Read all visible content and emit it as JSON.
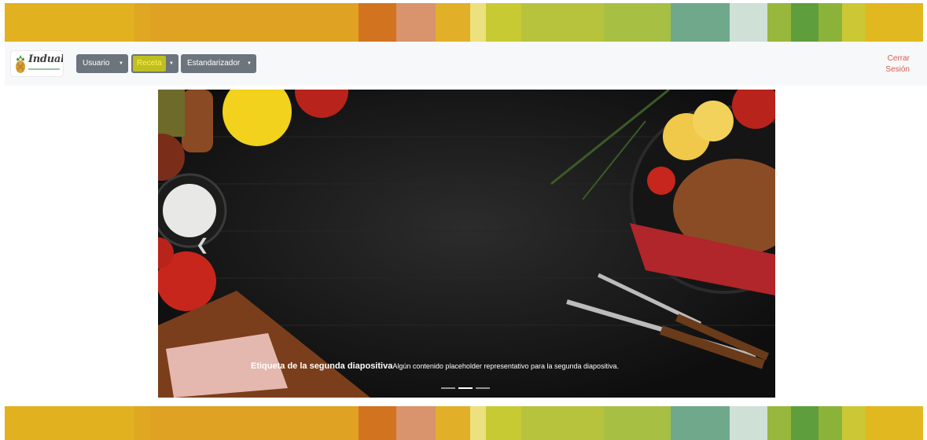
{
  "stripes": [
    {
      "color": "#e2b11f",
      "w": 165
    },
    {
      "color": "#e0a722",
      "w": 20
    },
    {
      "color": "#e0a222",
      "w": 265
    },
    {
      "color": "#d2731f",
      "w": 48
    },
    {
      "color": "#d9936d",
      "w": 50
    },
    {
      "color": "#e1b028",
      "w": 44
    },
    {
      "color": "#ede07e",
      "w": 20
    },
    {
      "color": "#c8ca33",
      "w": 45
    },
    {
      "color": "#b7c33d",
      "w": 105
    },
    {
      "color": "#a7c044",
      "w": 85
    },
    {
      "color": "#6fa88b",
      "w": 75
    },
    {
      "color": "#cfe0d7",
      "w": 48
    },
    {
      "color": "#97b83c",
      "w": 30
    },
    {
      "color": "#5f9e3c",
      "w": 35
    },
    {
      "color": "#8bb33a",
      "w": 30
    },
    {
      "color": "#ccc735",
      "w": 30
    },
    {
      "color": "#e1b81f",
      "w": 73
    }
  ],
  "brand": {
    "name": "Induali"
  },
  "nav": {
    "menus": [
      {
        "label": "Usuario"
      },
      {
        "label": "Receta"
      },
      {
        "label": "Estandarizador"
      }
    ],
    "logout_line1": "Cerrar",
    "logout_line2": "Sesión"
  },
  "carousel": {
    "prev_icon": "chevron-left-icon",
    "caption_title": "Etiqueta de la segunda diapositiva",
    "caption_text": "Algún contenido placeholder representativo para la segunda diapositiva.",
    "slide_count": 3,
    "active_slide": 2
  }
}
